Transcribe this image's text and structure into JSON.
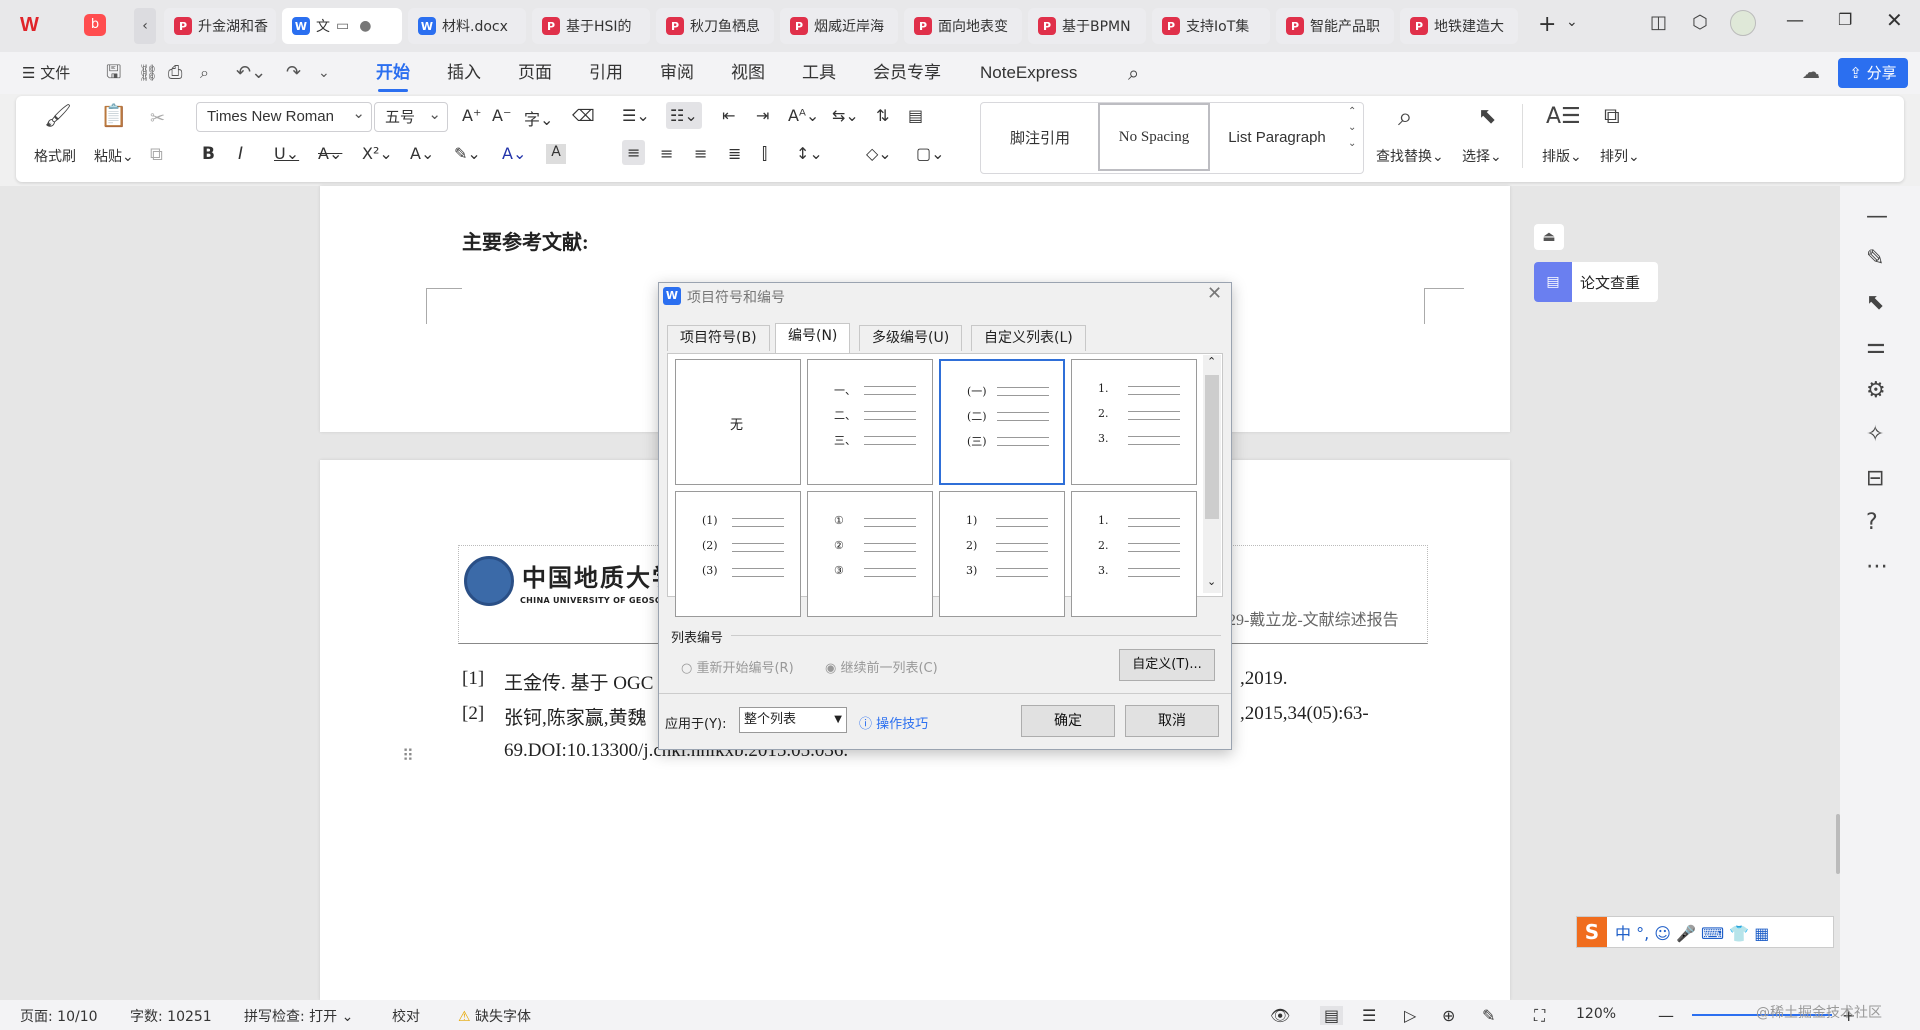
{
  "tabs": [
    {
      "label": "",
      "icon": "wps-logo"
    },
    {
      "label": "",
      "icon": "pdf-red-icon"
    },
    {
      "label": "升金湖和香"
    },
    {
      "label": "文",
      "active": true
    },
    {
      "label": "材料.docx"
    },
    {
      "label": "基于HSI的"
    },
    {
      "label": "秋刀鱼栖息"
    },
    {
      "label": "烟威近岸海"
    },
    {
      "label": "面向地表变"
    },
    {
      "label": "基于BPMN"
    },
    {
      "label": "支持IoT集"
    },
    {
      "label": "智能产品职"
    },
    {
      "label": "地铁建造大"
    }
  ],
  "menu": {
    "file": "文件",
    "items": [
      "开始",
      "插入",
      "页面",
      "引用",
      "审阅",
      "视图",
      "工具",
      "会员专享",
      "NoteExpress"
    ],
    "share": "分享"
  },
  "ribbon": {
    "format_painter": "格式刷",
    "paste": "粘贴",
    "font": "Times New Roman",
    "size": "五号",
    "styles": [
      "脚注引用",
      "No Spacing",
      "List Paragraph"
    ],
    "find_replace": "查找替换",
    "select": "选择",
    "layout": "排版",
    "arrange": "排列"
  },
  "doc": {
    "heading": "主要参考文献:",
    "univ_cn": "中国地质大学",
    "univ_en": "CHINA UNIVERSITY OF GEOSCIENCES",
    "header_right": "029-戴立龙-文献综述报告",
    "ref1_num": "[1]",
    "ref1_left": "王金传. 基于 OGC",
    "ref1_right": ",2019.",
    "ref2_num": "[2]",
    "ref2_left": "张钶,陈家赢,黄魏",
    "ref2_right": ",2015,34(05):63-",
    "ref2_line2": "69.DOI:10.13300/j.cnki.hnlkxb.2015.05.036."
  },
  "sidepanel": {
    "check": "论文查重"
  },
  "dialog": {
    "title": "项目符号和编号",
    "tabs": [
      "项目符号(B)",
      "编号(N)",
      "多级编号(U)",
      "自定义列表(L)"
    ],
    "none": "无",
    "cells": [
      {
        "labels": [
          "一、",
          "二、",
          "三、"
        ]
      },
      {
        "labels": [
          "(一)",
          "(二)",
          "(三)"
        ]
      },
      {
        "labels": [
          "1.",
          "2.",
          "3."
        ]
      },
      {
        "labels": [
          "(1)",
          "(2)",
          "(3)"
        ]
      },
      {
        "labels": [
          "①",
          "②",
          "③"
        ]
      },
      {
        "labels": [
          "1)",
          "2)",
          "3)"
        ]
      },
      {
        "labels": [
          "1.",
          "2.",
          "3."
        ]
      }
    ],
    "section": "列表编号",
    "restart": "重新开始编号(R)",
    "continue": "继续前一列表(C)",
    "custom": "自定义(T)...",
    "apply_label": "应用于(Y):",
    "apply_value": "整个列表",
    "tips": "操作技巧",
    "ok": "确定",
    "cancel": "取消"
  },
  "status": {
    "page": "页面: 10/10",
    "words": "字数: 10251",
    "spell": "拼写检查: 打开",
    "proof": "校对",
    "missing_font": "缺失字体",
    "zoom": "120%",
    "watermark": "@稀土掘金技术社区"
  },
  "ime": {
    "text": "中 °, ☺ 🎤 ⌨ 👕 ▦"
  }
}
